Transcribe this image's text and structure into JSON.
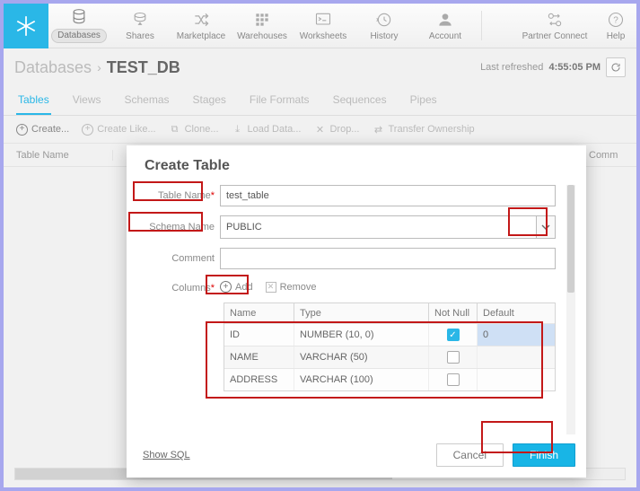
{
  "toolbar": {
    "items": [
      {
        "label": "Databases",
        "icon": "db-stack-icon"
      },
      {
        "label": "Shares",
        "icon": "share-icon"
      },
      {
        "label": "Marketplace",
        "icon": "shuffle-icon"
      },
      {
        "label": "Warehouses",
        "icon": "grid-icon"
      },
      {
        "label": "Worksheets",
        "icon": "terminal-icon"
      },
      {
        "label": "History",
        "icon": "history-icon"
      },
      {
        "label": "Account",
        "icon": "user-icon"
      },
      {
        "label": "Partner Connect",
        "icon": "swap-icon"
      },
      {
        "label": "Help",
        "icon": "help-icon"
      }
    ]
  },
  "breadcrumb": {
    "root": "Databases",
    "name": "TEST_DB",
    "refreshed_label": "Last refreshed",
    "refreshed_time": "4:55:05 PM"
  },
  "tabs": [
    "Tables",
    "Views",
    "Schemas",
    "Stages",
    "File Formats",
    "Sequences",
    "Pipes"
  ],
  "actions": {
    "create": "Create...",
    "create_like": "Create Like...",
    "clone": "Clone...",
    "load": "Load Data...",
    "drop": "Drop...",
    "transfer": "Transfer Ownership"
  },
  "bg_headers": {
    "first": "Table Name",
    "last": "Comm"
  },
  "modal": {
    "title": "Create Table",
    "labels": {
      "table_name": "Table Name",
      "schema_name": "Schema Name",
      "comment": "Comment",
      "columns": "Columns",
      "required": "*"
    },
    "values": {
      "table_name": "test_table",
      "schema_name": "PUBLIC",
      "comment": ""
    },
    "col_buttons": {
      "add": "Add",
      "remove": "Remove"
    },
    "col_headers": {
      "name": "Name",
      "type": "Type",
      "not_null": "Not Null",
      "default": "Default"
    },
    "columns": [
      {
        "name": "ID",
        "type": "NUMBER (10, 0)",
        "not_null": true,
        "default": "0"
      },
      {
        "name": "NAME",
        "type": "VARCHAR (50)",
        "not_null": false,
        "default": ""
      },
      {
        "name": "ADDRESS",
        "type": "VARCHAR (100)",
        "not_null": false,
        "default": ""
      }
    ],
    "footer": {
      "show_sql": "Show SQL",
      "cancel": "Cancel",
      "finish": "Finish"
    }
  }
}
